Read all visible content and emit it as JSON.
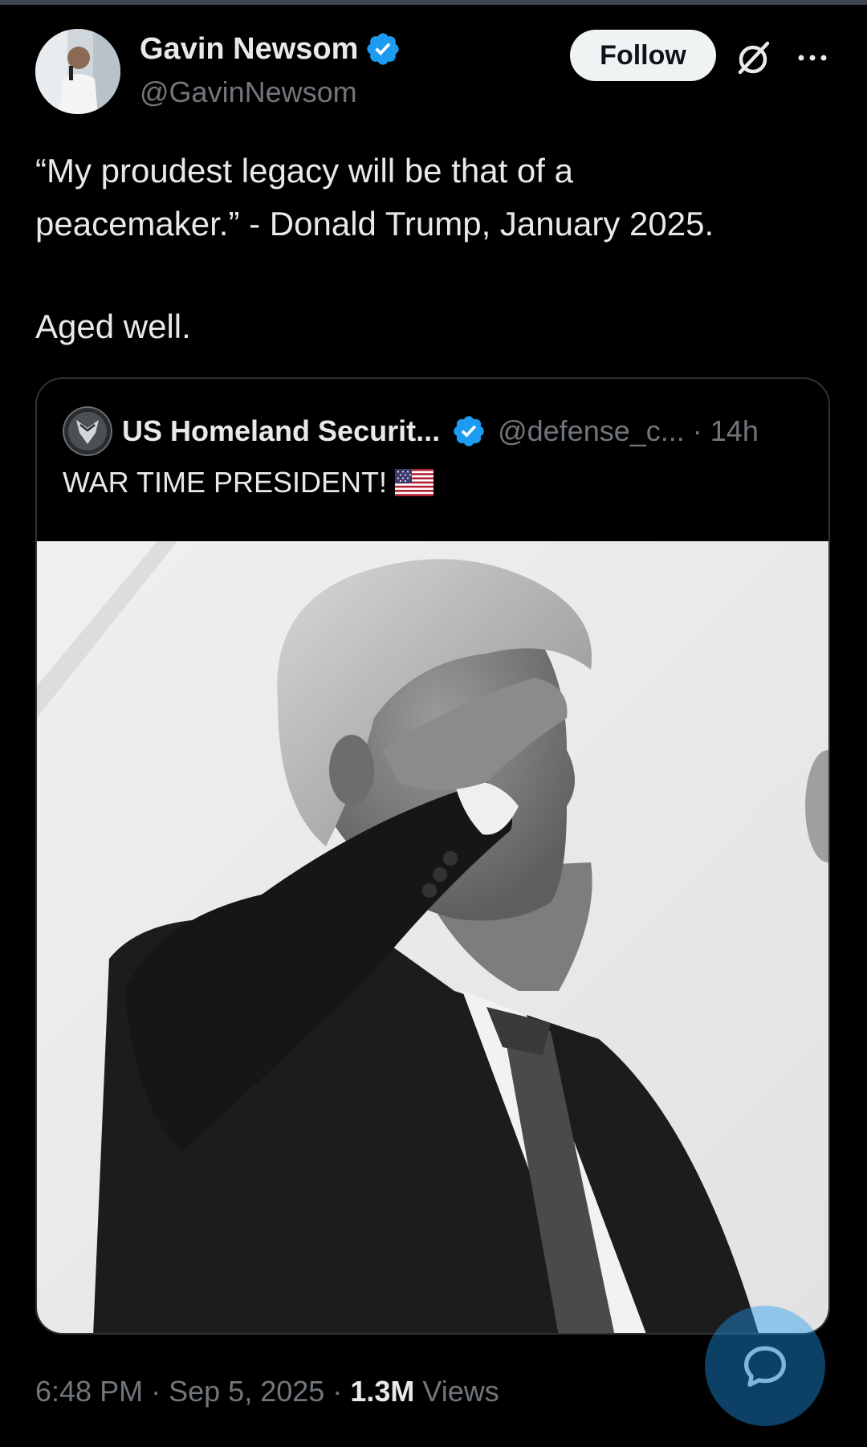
{
  "author": {
    "name": "Gavin Newsom",
    "handle": "@GavinNewsom"
  },
  "header": {
    "follow_label": "Follow",
    "icons": [
      "verified-badge-icon",
      "grok-icon",
      "more-icon"
    ]
  },
  "tweet": {
    "line1": "“My proudest legacy will be that of a",
    "line2": "peacemaker.” - Donald Trump, January 2025.",
    "line3": "Aged well."
  },
  "quote": {
    "name": "US Homeland Securit...",
    "handle": "@defense_c...",
    "separator": "·",
    "time": "14h",
    "text": "WAR TIME PRESIDENT!",
    "media_description_icon": "black-and-white-salute-photo"
  },
  "footer": {
    "time": "6:48 PM",
    "sep1": "·",
    "date": "Sep 5, 2025",
    "sep2": "·",
    "views_count": "1.3M",
    "views_label": "Views"
  },
  "colors": {
    "background": "#000000",
    "text_primary": "#e7e9ea",
    "text_secondary": "#71767b",
    "verified_blue": "#1d9bf0",
    "border": "#2f3336"
  }
}
